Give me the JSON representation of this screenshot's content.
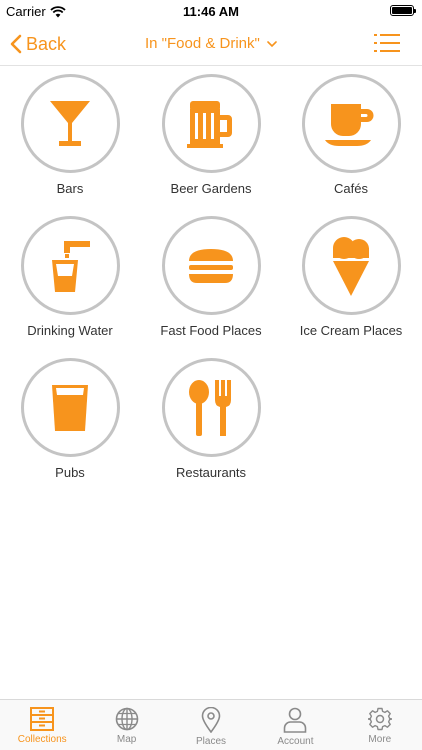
{
  "status": {
    "carrier": "Carrier",
    "time": "11:46 AM"
  },
  "nav": {
    "back_label": "Back",
    "title": "In \"Food & Drink\""
  },
  "categories": [
    {
      "label": "Bars",
      "icon": "cocktail-glass-icon"
    },
    {
      "label": "Beer Gardens",
      "icon": "beer-mug-icon"
    },
    {
      "label": "Cafés",
      "icon": "coffee-cup-icon"
    },
    {
      "label": "Drinking Water",
      "icon": "water-tap-icon"
    },
    {
      "label": "Fast Food Places",
      "icon": "burger-icon"
    },
    {
      "label": "Ice Cream Places",
      "icon": "ice-cream-cone-icon"
    },
    {
      "label": "Pubs",
      "icon": "pint-glass-icon"
    },
    {
      "label": "Restaurants",
      "icon": "spoon-fork-icon"
    }
  ],
  "tabs": [
    {
      "label": "Collections",
      "icon": "collections-icon",
      "active": true
    },
    {
      "label": "Map",
      "icon": "globe-icon",
      "active": false
    },
    {
      "label": "Places",
      "icon": "location-pin-icon",
      "active": false
    },
    {
      "label": "Account",
      "icon": "user-icon",
      "active": false
    },
    {
      "label": "More",
      "icon": "gear-icon",
      "active": false
    }
  ],
  "colors": {
    "accent": "#f7941d",
    "circle_border": "#c4c4c4",
    "inactive": "#8a8a8a"
  }
}
